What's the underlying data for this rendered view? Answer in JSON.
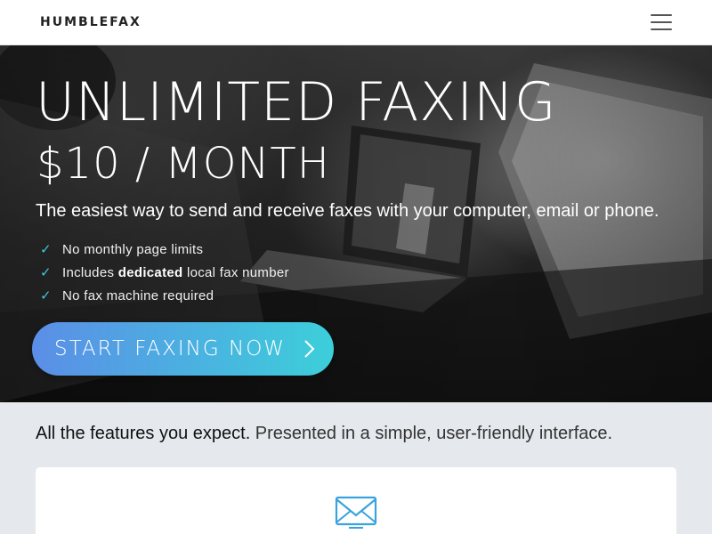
{
  "navbar": {
    "brand": "HUMBLEFAX",
    "menu_icon": "hamburger-menu-icon"
  },
  "hero": {
    "title": "UNLIMITED FAXING",
    "price": "$10 / MONTH",
    "subtitle": "The easiest way to send and receive faxes with your computer, email or phone.",
    "benefits": [
      {
        "icon": "check-icon",
        "text": "No monthly page limits"
      },
      {
        "icon": "check-icon",
        "prefix": "Includes ",
        "bold": "dedicated",
        "suffix": " local fax number"
      },
      {
        "icon": "check-icon",
        "text": "No fax machine required"
      }
    ],
    "cta": {
      "label": "START FAXING NOW",
      "icon": "chevron-right-icon"
    },
    "check_glyph": "✓"
  },
  "features": {
    "intro_strong": "All the features you expect.",
    "intro_light": " Presented in a simple, user-friendly interface.",
    "card_icon": "envelope-icon"
  },
  "colors": {
    "accent_start": "#5b8ee6",
    "accent_end": "#3ccfda",
    "check": "#3fc7dc",
    "section_bg": "#e5e8ed"
  }
}
